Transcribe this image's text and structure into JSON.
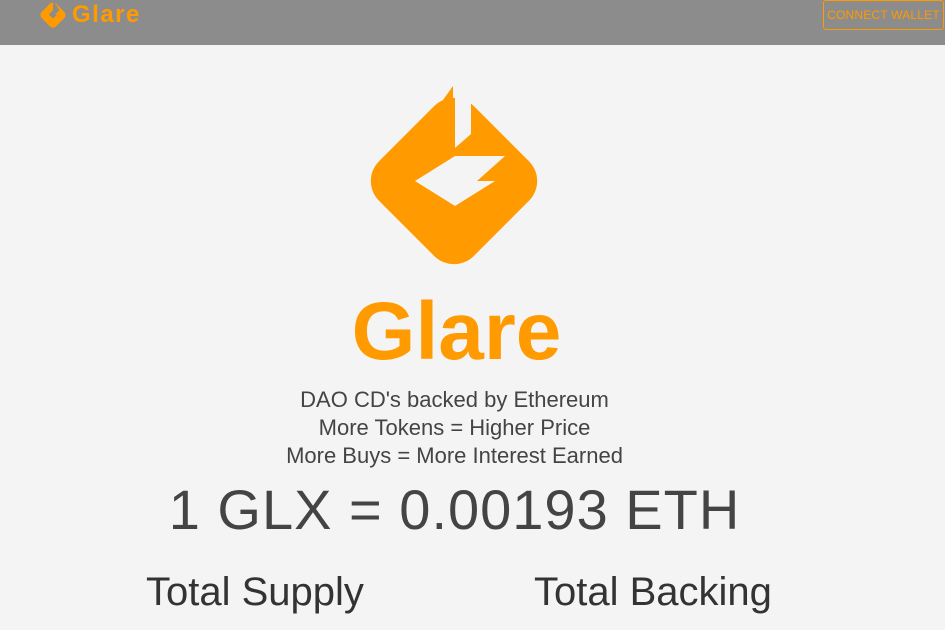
{
  "header": {
    "brand_name": "Glare",
    "connect_label": "CONNECT WALLET"
  },
  "hero": {
    "title": "Glare",
    "taglines": [
      "DAO CD's backed by Ethereum",
      "More Tokens = Higher Price",
      "More Buys = More Interest Earned"
    ],
    "price": "1 GLX = 0.00193 ETH"
  },
  "stats": {
    "total_supply_label": "Total Supply",
    "total_backing_label": "Total Backing"
  },
  "colors": {
    "accent": "#ff9a00",
    "header_bg": "#8c8c8c",
    "page_bg": "#f4f4f4",
    "text": "#444444"
  },
  "icons": {
    "brand": "glare-logo-icon",
    "hero": "glare-logo-icon"
  }
}
